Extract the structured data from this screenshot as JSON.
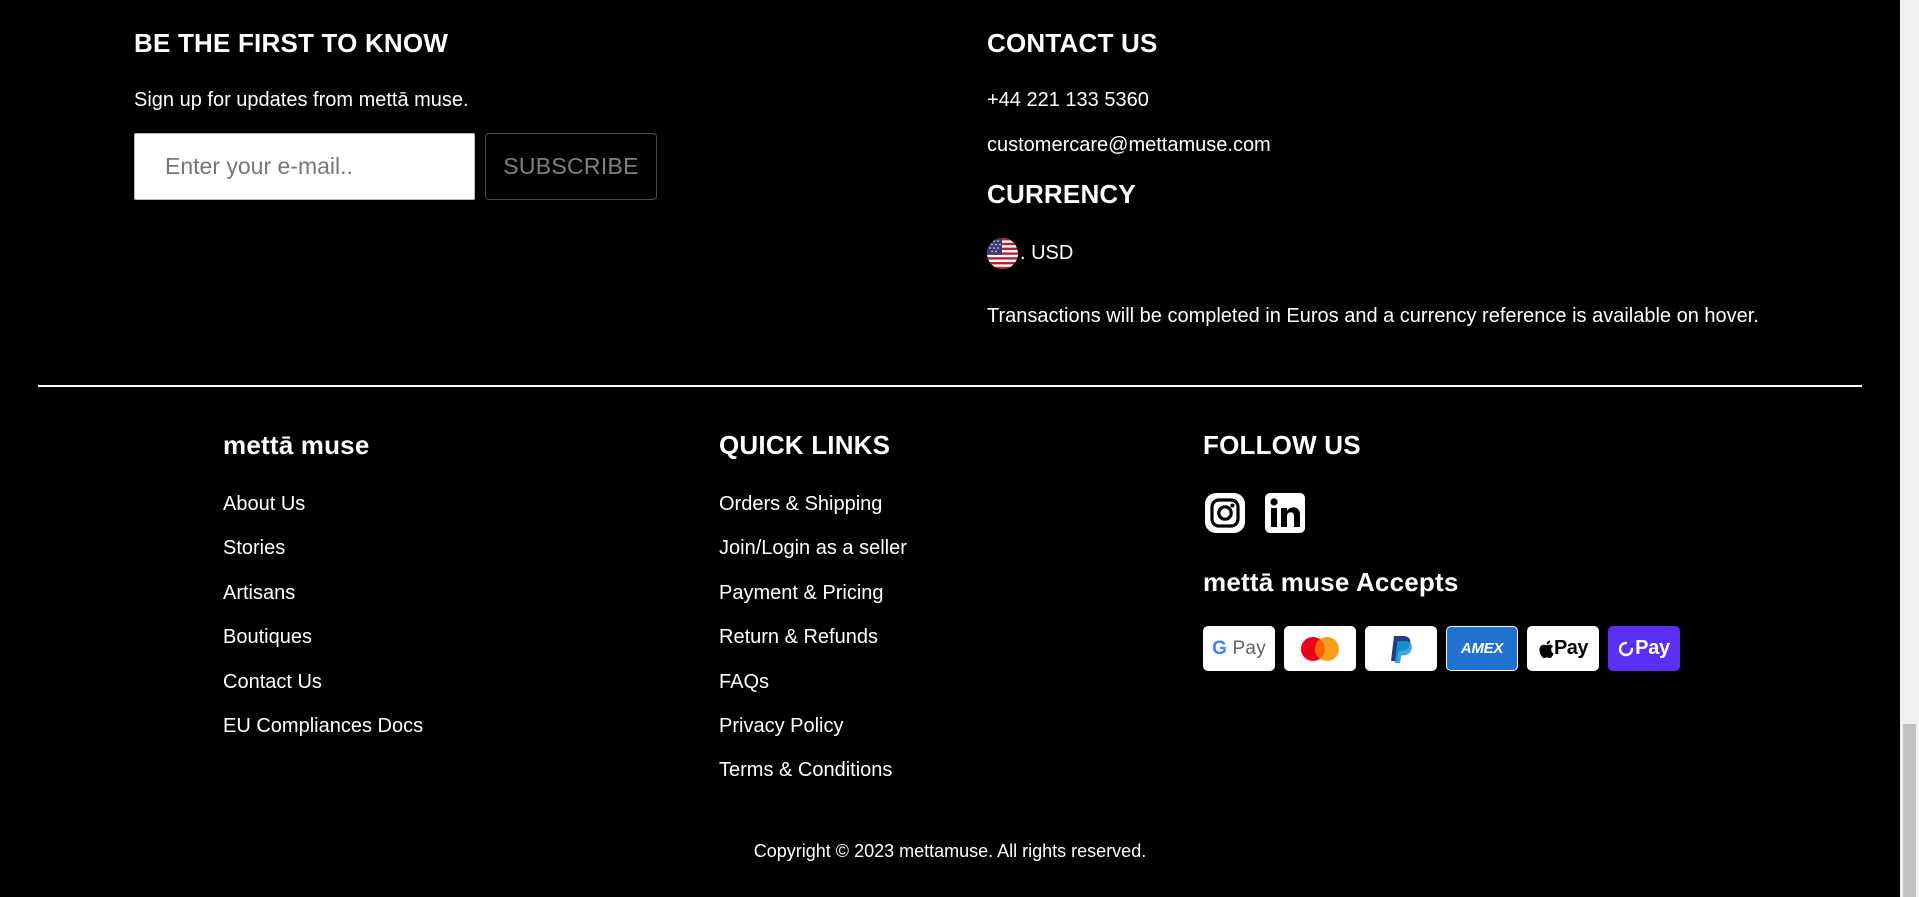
{
  "newsletter": {
    "heading": "BE THE FIRST TO KNOW",
    "subtext": "Sign up for updates from mettā muse.",
    "email_placeholder": "Enter your e-mail..",
    "subscribe_label": "SUBSCRIBE"
  },
  "contact": {
    "heading": "CONTACT US",
    "phone": "+44 221 133 5360",
    "email": "customercare@mettamuse.com"
  },
  "currency": {
    "heading": "CURRENCY",
    "flag_icon": "us-flag-icon",
    "label": ". USD",
    "note": "Transactions will be completed in Euros and a currency reference is available on hover."
  },
  "brand": {
    "heading": "mettā muse",
    "links": [
      "About Us",
      "Stories",
      "Artisans",
      "Boutiques",
      "Contact Us",
      "EU Compliances Docs"
    ]
  },
  "quick_links": {
    "heading": "QUICK LINKS",
    "links": [
      "Orders & Shipping",
      "Join/Login as a seller",
      "Payment & Pricing",
      "Return & Refunds",
      "FAQs",
      "Privacy Policy",
      "Terms & Conditions"
    ]
  },
  "follow": {
    "heading": "FOLLOW US",
    "icons": [
      "instagram-icon",
      "linkedin-icon"
    ]
  },
  "accepts": {
    "heading": "mettā muse Accepts",
    "methods": [
      "Google Pay",
      "Mastercard",
      "PayPal",
      "American Express",
      "Apple Pay",
      "Shop Pay"
    ],
    "gpay_g": "G",
    "gpay_pay": " Pay",
    "amex_label": "AMEX",
    "apple_label": " Pay",
    "shop_label": "Pay"
  },
  "colors": {
    "background": "#000000",
    "text": "#ffffff",
    "amex_blue": "#1f72cd",
    "shop_purple": "#5a31f4"
  },
  "copyright": "Copyright © 2023 mettamuse. All rights reserved."
}
